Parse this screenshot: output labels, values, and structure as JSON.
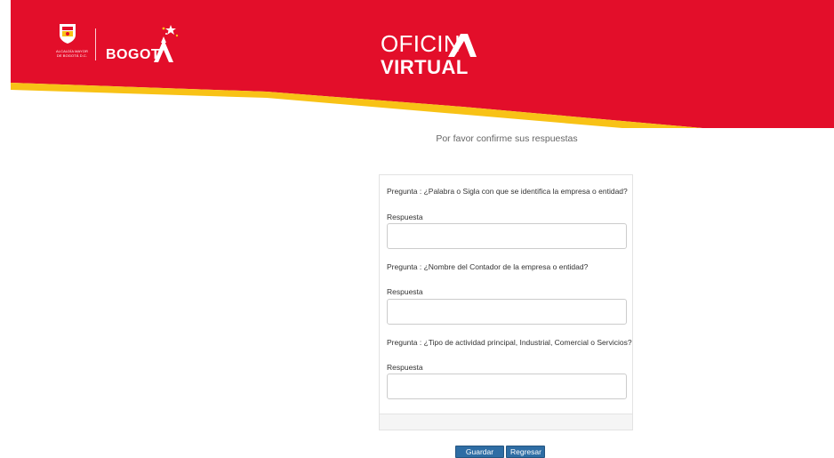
{
  "header": {
    "alcaldia_line1": "ALCALDÍA MAYOR",
    "alcaldia_line2": "DE BOGOTÁ D.C.",
    "bogota_logo_text": "BOGOT",
    "title_line1": "OFICIN",
    "title_line2": "VIRTUAL",
    "colors": {
      "brand_red": "#e30e2a",
      "accent_yellow": "#f8c216"
    }
  },
  "main": {
    "confirm_message": "Por favor confirme sus respuestas",
    "questions": [
      {
        "pregunta": "Pregunta : ¿Palabra o Sigla con que se identifica la empresa o entidad?",
        "respuesta_label": "Respuesta",
        "value": ""
      },
      {
        "pregunta": "Pregunta : ¿Nombre del Contador de la empresa o entidad?",
        "respuesta_label": "Respuesta",
        "value": ""
      },
      {
        "pregunta": "Pregunta : ¿Tipo de actividad principal, Industrial, Comercial o Servicios?",
        "respuesta_label": "Respuesta",
        "value": ""
      }
    ],
    "buttons": {
      "save_label": "Guardar",
      "back_label": "Regresar"
    }
  }
}
